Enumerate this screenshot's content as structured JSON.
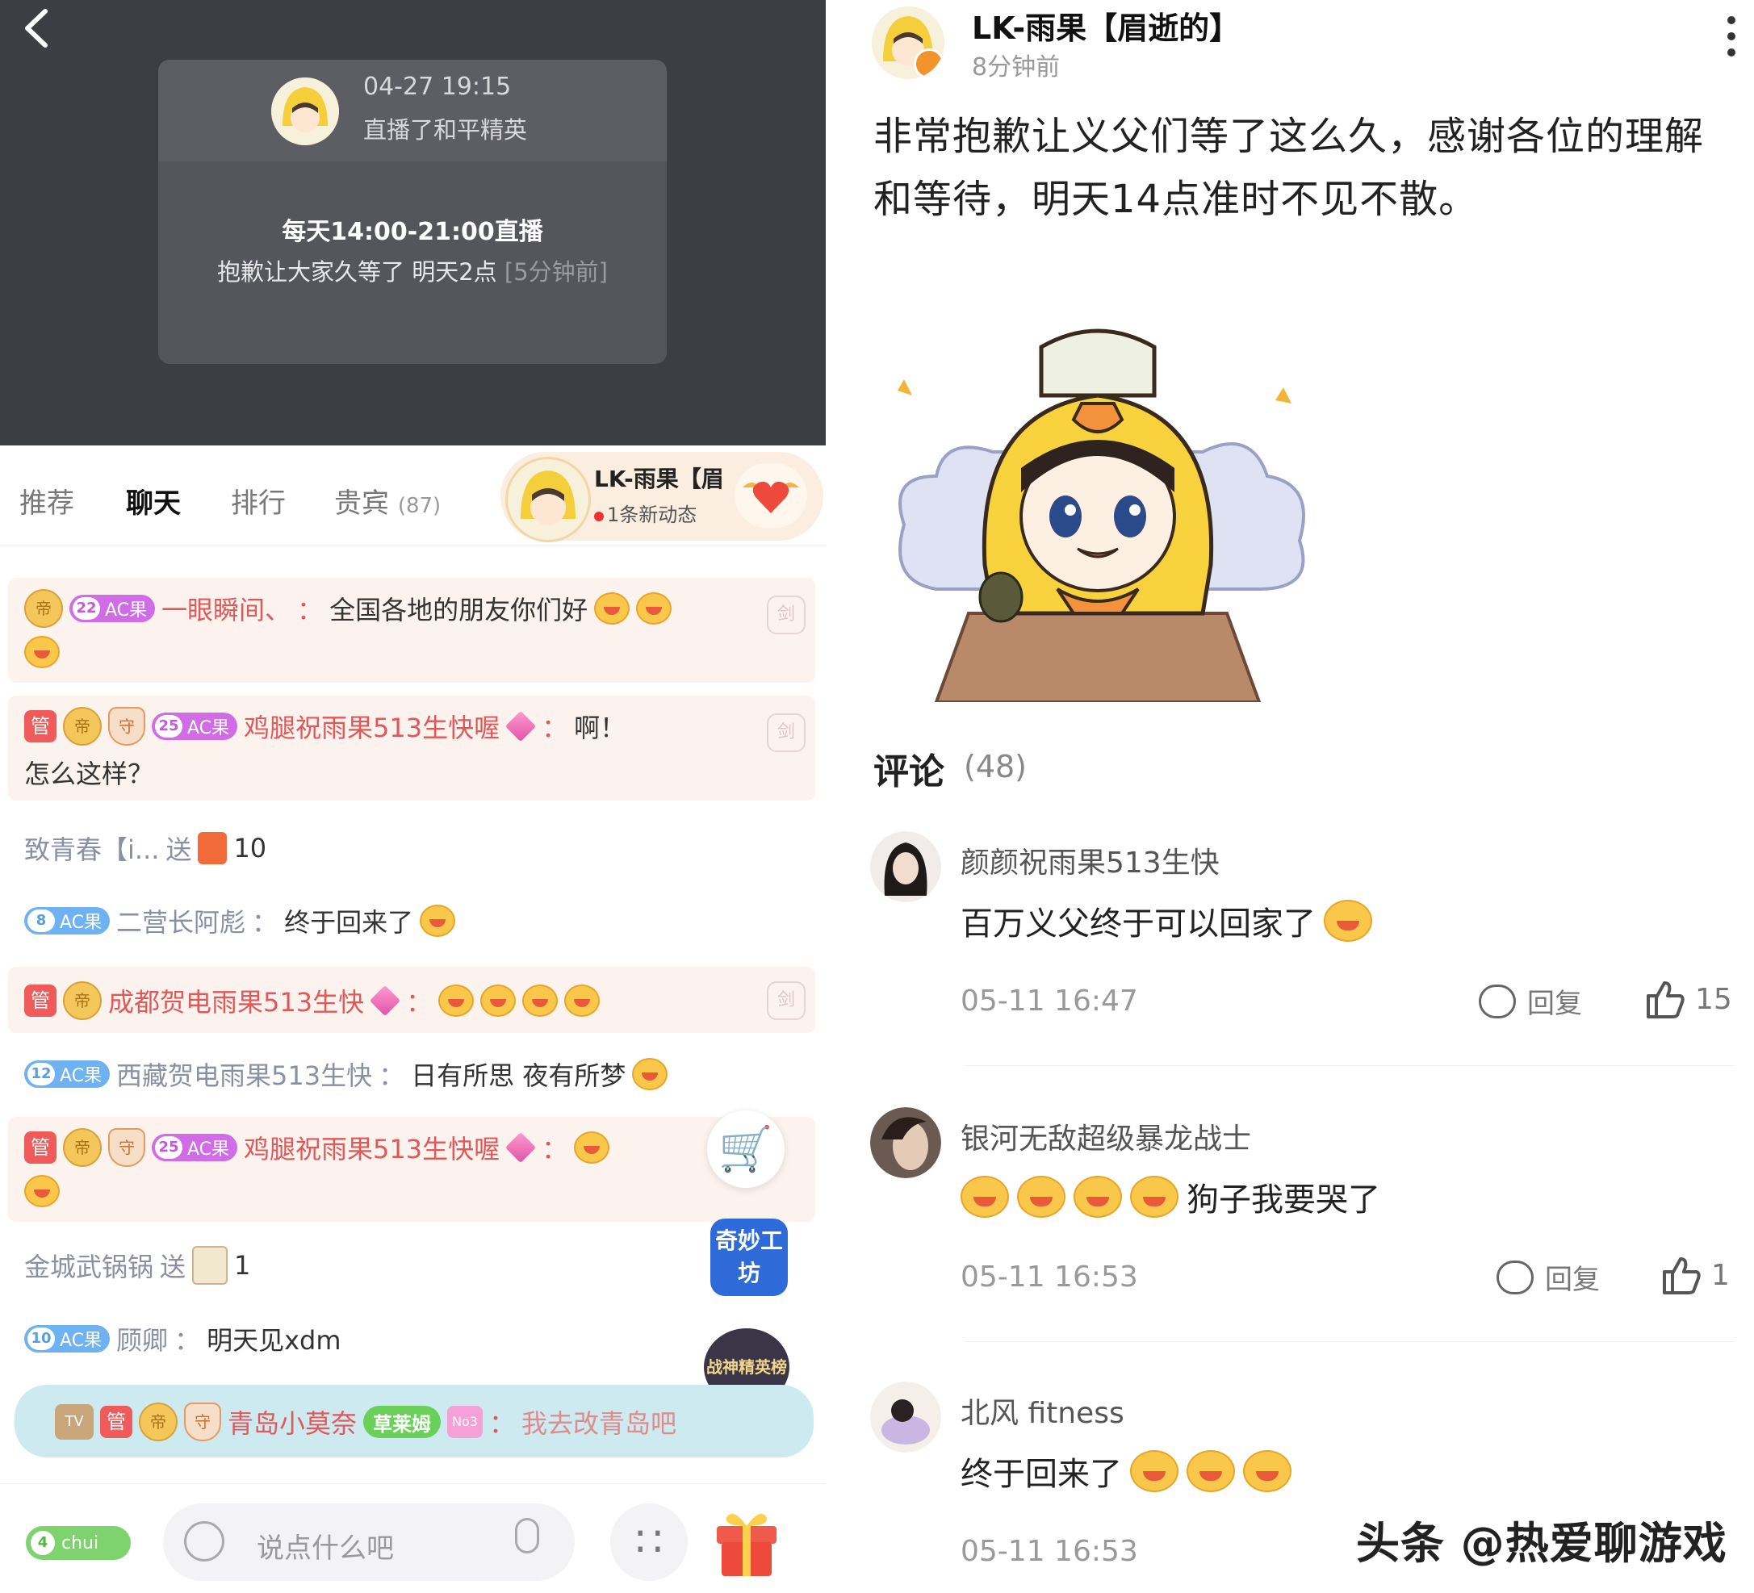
{
  "left": {
    "card": {
      "date": "04-27 19:15",
      "activity": "直播了和平精英",
      "schedule": "每天14:00-21:00直播",
      "apology": "抱歉让大家久等了 明天2点",
      "ago": "[5分钟前]"
    },
    "tabs": [
      {
        "label": "推荐"
      },
      {
        "label": "聊天"
      },
      {
        "label": "排行"
      },
      {
        "label": "贵宾",
        "count": "(87)"
      }
    ],
    "active_tab": "聊天",
    "streamer": {
      "name": "LK-雨果【眉",
      "update": "1条新动态"
    },
    "messages": [
      {
        "level": "22",
        "badge": "AC果",
        "name": "一眼瞬间、",
        "sep": "：",
        "text": "全国各地的朋友你们好"
      },
      {
        "role": "管",
        "level": "25",
        "badge": "AC果",
        "name": "鸡腿祝雨果513生快喔",
        "sep": "：",
        "text": "啊！",
        "text2": "怎么这样？"
      },
      {
        "name": "致青春【i...",
        "action": "送",
        "amount": "10"
      },
      {
        "level": "8",
        "badge": "AC果",
        "name": "二营长阿彪",
        "sep": "：",
        "text": "终于回来了"
      },
      {
        "role": "管",
        "name": "成都贺电雨果513生快",
        "sep": "："
      },
      {
        "level": "12",
        "badge": "AC果",
        "name": "西藏贺电雨果513生快",
        "sep": "：",
        "text": "日有所思 夜有所梦"
      },
      {
        "role": "管",
        "level": "25",
        "badge": "AC果",
        "name": "鸡腿祝雨果513生快喔",
        "sep": "："
      },
      {
        "name": "金城武锅锅",
        "action": "送",
        "amount": "1"
      },
      {
        "level": "10",
        "badge": "AC果",
        "name": "顾卿",
        "sep": "：",
        "text": "明天见xdm"
      }
    ],
    "join": {
      "role": "管",
      "name": "青岛小莫奈",
      "grass": "草莱姆",
      "sep": "：",
      "text": "我去改青岛吧"
    },
    "side": {
      "workshop": "奇妙工坊",
      "rank": "战神精英榜"
    },
    "bottom": {
      "level": "4",
      "user": "chui",
      "placeholder": "说点什么吧"
    }
  },
  "right": {
    "author": "LK-雨果【眉逝的】",
    "time": "8分钟前",
    "body": "非常抱歉让义父们等了这么久，感谢各位的理解和等待，明天14点准时不见不散。",
    "comments_title": "评论",
    "comments_count": "(48)",
    "comments": [
      {
        "name": "颜颜祝雨果513生快",
        "text": "百万义父终于可以回家了",
        "time": "05-11 16:47",
        "reply": "回复",
        "likes": "15"
      },
      {
        "name": "银河无敌超级暴龙战士",
        "text": "狗子我要哭了",
        "time": "05-11 16:53",
        "reply": "回复",
        "likes": "1"
      },
      {
        "name": "北风 fitness",
        "text": "终于回来了",
        "time": "05-11 16:53"
      }
    ],
    "watermark": "头条 @热爱聊游戏"
  },
  "colors": {
    "accent_red": "#e05858",
    "name_grey": "#8a8fa6",
    "video_bg": "#3d3d44"
  }
}
